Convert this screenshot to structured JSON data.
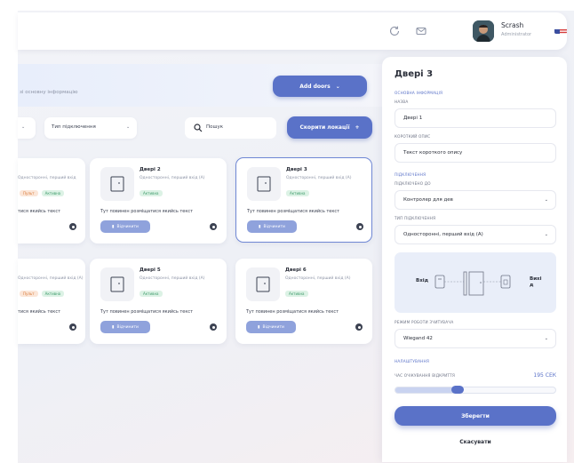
{
  "header": {
    "user_name": "Scrash",
    "user_role": "Administrator",
    "icons": [
      "refresh-icon",
      "mail-icon"
    ]
  },
  "banner": {
    "text": "зі основну інформацію",
    "add_button": "Add doors",
    "add_chevron": "⌄"
  },
  "filters": {
    "left_chevron": "⌄",
    "connection_type": "Тип підключення",
    "connection_chevron": "⌄",
    "search_placeholder": "Пошук",
    "reset_button": "Скорити локації",
    "reset_icon": "+"
  },
  "cards": [
    {
      "title": "Двері 2",
      "subtitle": "Односторонні, перший вхід (А)",
      "tag": "Активна",
      "text": "Тут повинен розміщатися якийсь текст",
      "button": "Відчинити",
      "selected": false
    },
    {
      "title": "Двері 3",
      "subtitle": "Односторонні, перший вхід (А)",
      "tag": "Активна",
      "text": "Тут повинен розміщатися якийсь текст",
      "button": "Відчинити",
      "selected": true
    },
    {
      "title": "Двері 5",
      "subtitle": "Односторонні, перший вхід (А)",
      "tag": "Активна",
      "text": "Тут повинен розміщатися якийсь текст",
      "button": "Відчинити",
      "selected": false
    },
    {
      "title": "Двері 6",
      "subtitle": "Односторонні, перший вхід (А)",
      "tag": "Активна",
      "text": "Тут повинен розміщатися якийсь текст",
      "button": "Відчинити",
      "selected": false
    }
  ],
  "partial_cards": [
    {
      "subtitle": "Односторонні, перший вхід",
      "tag_orange": "Пульт",
      "tag_green": "Активна",
      "text": "тися якийсь текст"
    },
    {
      "subtitle": "Односторонні, перший вхід (А)",
      "tag_orange": "Пульт",
      "tag_green": "Активна",
      "text": "тися якийсь текст"
    }
  ],
  "panel": {
    "title": "Двері 3",
    "section_main": "ОСНОВНА ІНФОРМАЦІЯ",
    "name_label": "НАЗВА",
    "name_value": "Двері 1",
    "short_desc_label": "КОРОТКИЙ ОПИС",
    "short_desc_value": "Текст короткого опису",
    "section_connection": "ПІДКЛЮЧЕННЯ",
    "connected_to_label": "ПІДКЛЮЧЕНО ДО",
    "connected_to_value": "Контролер для дев",
    "connection_type_label": "ТИП ПІДКЛЮЧЕННЯ",
    "connection_type_value": "Односторонні, перший вхід (А)",
    "diagram_in": "Вхід",
    "diagram_out": "Вихі д",
    "reader_mode_label": "РЕЖИМ РОБОТИ ЗЧИТУВАЧА",
    "reader_mode_value": "Wiegand 42",
    "section_settings": "НАЛАШТУВАННЯ",
    "wait_time_label": "ЧАС ОЧІКУВАННЯ ВІДКРИТТЯ",
    "wait_time_value": "195 СЕК",
    "slider_fraction": 0.38,
    "chevron": "⌄",
    "save_button": "Зберегти",
    "cancel_button": "Скасувати"
  },
  "colors": {
    "accent": "#5a72c8",
    "accent_soft": "#8fa2dc",
    "tag_green": "#3d9a6a",
    "tag_orange": "#d97b3b"
  }
}
